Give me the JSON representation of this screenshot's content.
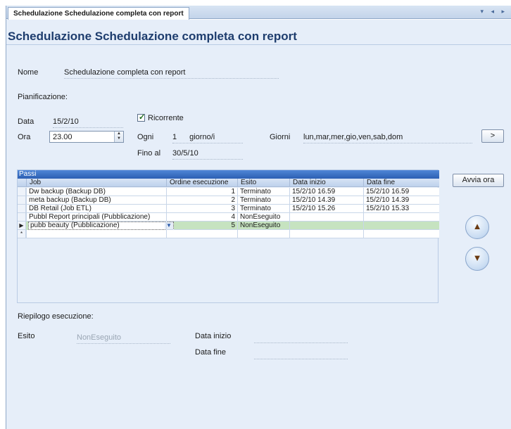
{
  "tab": {
    "title": "Schedulazione Schedulazione completa con report",
    "controls": "▾ ◂ ▸"
  },
  "page_title": "Schedulazione Schedulazione completa con report",
  "nome": {
    "label": "Nome",
    "value": "Schedulazione completa con report"
  },
  "pianificazione_label": "Pianificazione:",
  "data": {
    "label": "Data",
    "value": "15/2/10"
  },
  "ricorrente": {
    "label": "Ricorrente",
    "checked": true
  },
  "ora": {
    "label": "Ora",
    "value": "23.00"
  },
  "ogni": {
    "label": "Ogni",
    "value": "1",
    "unit": "giorno/i"
  },
  "giorni": {
    "label": "Giorni",
    "value": "lun,mar,mer,gio,ven,sab,dom",
    "button": ">"
  },
  "fino_al": {
    "label": "Fino al",
    "value": "30/5/10"
  },
  "avvia_ora": "Avvia ora",
  "passi": {
    "caption": "Passi",
    "columns": [
      "Job",
      "Ordine esecuzione",
      "Esito",
      "Data inizio",
      "Data fine"
    ],
    "rows": [
      {
        "job": "Dw backup (Backup DB)",
        "ordine": "1",
        "esito": "Terminato",
        "inizio": "15/2/10 16.59",
        "fine": "15/2/10 16.59"
      },
      {
        "job": "meta backup (Backup DB)",
        "ordine": "2",
        "esito": "Terminato",
        "inizio": "15/2/10 14.39",
        "fine": "15/2/10 14.39"
      },
      {
        "job": "DB Retail (Job ETL)",
        "ordine": "3",
        "esito": "Terminato",
        "inizio": "15/2/10 15.26",
        "fine": "15/2/10 15.33"
      },
      {
        "job": "Pubbl Report principali (Pubblicazione)",
        "ordine": "4",
        "esito": "NonEseguito",
        "inizio": "",
        "fine": ""
      },
      {
        "job": "pubb beauty (Pubblicazione)",
        "ordine": "5",
        "esito": "NonEseguito",
        "inizio": "",
        "fine": ""
      }
    ],
    "selected_row": 4,
    "new_row_marker": "*",
    "current_row_marker": "▶"
  },
  "move_up_icon": "arrow-up-icon",
  "move_down_icon": "arrow-down-icon",
  "riepilogo": {
    "label": "Riepilogo esecuzione:",
    "esito_label": "Esito",
    "esito_value": "NonEseguito",
    "data_inizio_label": "Data inizio",
    "data_inizio_value": "",
    "data_fine_label": "Data fine",
    "data_fine_value": ""
  },
  "colors": {
    "accent": "#1e3d6e",
    "grid_caption": "#2c5fb3",
    "selected_row": "#c6e3c0",
    "background": "#e6eef9"
  }
}
